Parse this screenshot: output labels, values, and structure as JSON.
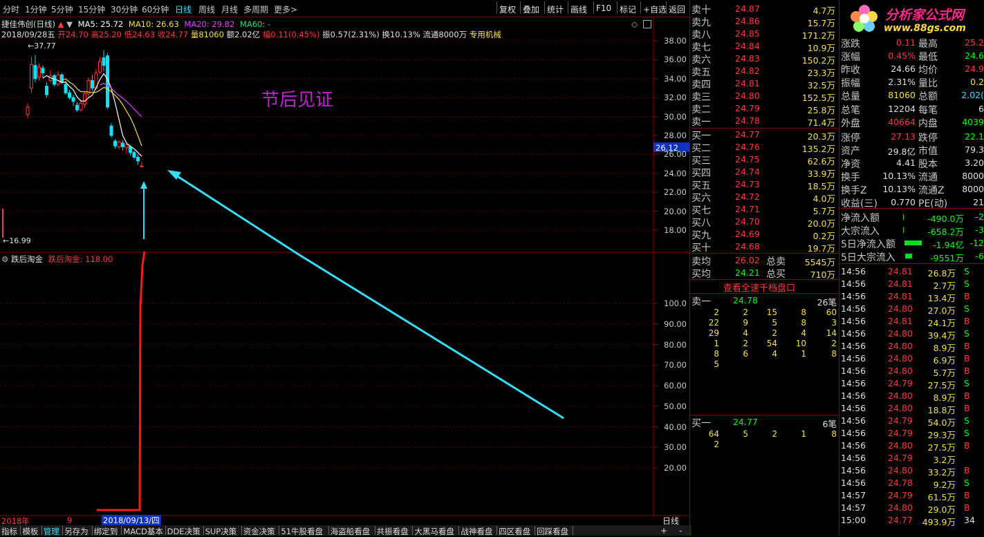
{
  "colors": {
    "up": "#ff3a3a",
    "down": "#00e5ff",
    "ma5": "#ffffff",
    "ma10": "#f4e04a",
    "ma20": "#e040fb",
    "accent": "#35e0ff",
    "grid": "#8c0000",
    "logo": "#ff2a8a"
  },
  "periods": [
    "分时",
    "1分钟",
    "5分钟",
    "15分钟",
    "30分钟",
    "60分钟",
    "日线",
    "周线",
    "月线",
    "多周期",
    "更多>"
  ],
  "active_period": "日线",
  "tools": [
    "复权",
    "叠加",
    "统计",
    "画线",
    "F10",
    "标记",
    "+自选",
    "返回"
  ],
  "stock": {
    "name": "捷佳伟创(日线)",
    "ma5": "MA5: 25.72",
    "ma10": "MA10: 26.63",
    "ma20": "MA20: 29.82",
    "ma60": "MA60: -",
    "line2": {
      "date": "2018/09/28五",
      "open": "开24.70",
      "high": "高25.20",
      "low": "低24.63",
      "close": "收24.77",
      "vol": "量81060",
      "amt": "额2.02亿",
      "chg": "幅0.11(0.45%)",
      "amp": "振0.57(2.31%)",
      "turn": "换10.13%",
      "float": "流通8000万",
      "sector": "专用机械"
    },
    "hi_label": "37.77",
    "lo_label": "16.99",
    "cur_price": "26.12"
  },
  "main_chart": {
    "annotation": "节后见证",
    "yticks": [
      "38.00",
      "36.00",
      "34.00",
      "32.00",
      "30.00",
      "28.00",
      "26.00",
      "24.00",
      "22.00",
      "20.00",
      "18.00"
    ],
    "candles": [
      {
        "o": 30.2,
        "c": 31.0,
        "h": 31.4,
        "l": 29.8
      },
      {
        "o": 33.0,
        "c": 35.5,
        "h": 36.3,
        "l": 32.5
      },
      {
        "o": 35.4,
        "c": 34.0,
        "h": 36.5,
        "l": 33.6
      },
      {
        "o": 34.2,
        "c": 35.2,
        "h": 35.6,
        "l": 33.8
      },
      {
        "o": 35.1,
        "c": 34.6,
        "h": 35.4,
        "l": 34.1
      },
      {
        "o": 33.2,
        "c": 32.3,
        "h": 33.6,
        "l": 32.0
      },
      {
        "o": 33.8,
        "c": 34.3,
        "h": 34.9,
        "l": 33.6
      },
      {
        "o": 34.3,
        "c": 33.4,
        "h": 34.5,
        "l": 33.2
      },
      {
        "o": 33.4,
        "c": 34.4,
        "h": 34.8,
        "l": 33.2
      },
      {
        "o": 34.4,
        "c": 33.6,
        "h": 34.6,
        "l": 33.4
      },
      {
        "o": 33.4,
        "c": 32.5,
        "h": 33.8,
        "l": 32.3
      },
      {
        "o": 32.5,
        "c": 32.0,
        "h": 32.8,
        "l": 31.8
      },
      {
        "o": 32.0,
        "c": 31.6,
        "h": 32.3,
        "l": 31.1
      },
      {
        "o": 31.2,
        "c": 30.7,
        "h": 31.5,
        "l": 30.5
      },
      {
        "o": 30.7,
        "c": 31.4,
        "h": 31.8,
        "l": 30.5
      },
      {
        "o": 31.3,
        "c": 32.4,
        "h": 32.6,
        "l": 30.9
      },
      {
        "o": 32.4,
        "c": 33.8,
        "h": 34.1,
        "l": 32.0
      },
      {
        "o": 33.8,
        "c": 33.0,
        "h": 34.4,
        "l": 32.7
      },
      {
        "o": 33.0,
        "c": 34.6,
        "h": 35.0,
        "l": 32.8
      },
      {
        "o": 34.7,
        "c": 35.8,
        "h": 36.3,
        "l": 34.5
      },
      {
        "o": 36.2,
        "c": 35.4,
        "h": 37.0,
        "l": 34.8
      },
      {
        "o": 36.4,
        "c": 31.0,
        "h": 36.7,
        "l": 30.8
      },
      {
        "o": 29.0,
        "c": 28.0,
        "h": 29.3,
        "l": 27.8
      },
      {
        "o": 27.4,
        "c": 26.9,
        "h": 27.6,
        "l": 26.6
      },
      {
        "o": 26.8,
        "c": 27.3,
        "h": 27.5,
        "l": 26.5
      },
      {
        "o": 27.2,
        "c": 26.8,
        "h": 27.5,
        "l": 26.4
      },
      {
        "o": 26.7,
        "c": 27.0,
        "h": 27.3,
        "l": 26.1
      },
      {
        "o": 26.8,
        "c": 26.2,
        "h": 27.0,
        "l": 25.9
      },
      {
        "o": 26.2,
        "c": 25.7,
        "h": 26.4,
        "l": 25.5
      },
      {
        "o": 25.7,
        "c": 25.3,
        "h": 26.0,
        "l": 24.9
      },
      {
        "o": 24.7,
        "c": 24.77,
        "h": 25.2,
        "l": 24.63
      }
    ]
  },
  "indicator": {
    "name": "跌后淘金",
    "series": "跌后淘金: 118.00",
    "yticks": [
      "100.0",
      "90.00",
      "80.00",
      "70.00",
      "60.00",
      "50.00",
      "40.00",
      "30.00",
      "20.00"
    ]
  },
  "date_bar": {
    "year": "2018年",
    "month": "9",
    "cursor": "2018/09/13/四",
    "cycle": "日线"
  },
  "bottom_tabs": [
    "指标",
    "模板",
    "管理",
    "另存为",
    "绑定到",
    "MACD基本",
    "DDE决策",
    "SUP决策",
    "资金决策",
    "51牛股看盘",
    "海盗船看盘",
    "共振看盘",
    "大黑马看盘",
    "战神看盘",
    "四区看盘",
    "回踩看盘"
  ],
  "bottom_active": "管理",
  "sell": [
    {
      "label": "卖十",
      "px": "24.87",
      "vol": "4.7万"
    },
    {
      "label": "卖九",
      "px": "24.86",
      "vol": "15.7万"
    },
    {
      "label": "卖八",
      "px": "24.85",
      "vol": "171.2万"
    },
    {
      "label": "卖七",
      "px": "24.84",
      "vol": "10.9万"
    },
    {
      "label": "卖六",
      "px": "24.83",
      "vol": "150.2万"
    },
    {
      "label": "卖五",
      "px": "24.82",
      "vol": "23.3万"
    },
    {
      "label": "卖四",
      "px": "24.81",
      "vol": "32.5万"
    },
    {
      "label": "卖三",
      "px": "24.80",
      "vol": "152.5万"
    },
    {
      "label": "卖二",
      "px": "24.79",
      "vol": "25.8万"
    },
    {
      "label": "卖一",
      "px": "24.78",
      "vol": "71.4万"
    }
  ],
  "buy": [
    {
      "label": "买一",
      "px": "24.77",
      "vol": "20.3万"
    },
    {
      "label": "买二",
      "px": "24.76",
      "vol": "135.2万"
    },
    {
      "label": "买三",
      "px": "24.75",
      "vol": "62.6万"
    },
    {
      "label": "买四",
      "px": "24.74",
      "vol": "33.9万"
    },
    {
      "label": "买五",
      "px": "24.73",
      "vol": "18.5万"
    },
    {
      "label": "买六",
      "px": "24.72",
      "vol": "4.0万"
    },
    {
      "label": "买七",
      "px": "24.71",
      "vol": "5.7万"
    },
    {
      "label": "买八",
      "px": "24.70",
      "vol": "20.0万"
    },
    {
      "label": "买九",
      "px": "24.69",
      "vol": "0.2万"
    },
    {
      "label": "买十",
      "px": "24.68",
      "vol": "19.7万"
    }
  ],
  "avg": {
    "sell_label": "卖均",
    "sell_px": "26.02",
    "sell_total_label": "总卖",
    "sell_total": "5545万",
    "buy_label": "买均",
    "buy_px": "24.21",
    "buy_total_label": "总买",
    "buy_total": "710万"
  },
  "depth_link": "查看全速千档盘口",
  "queue_sell": {
    "label": "卖一",
    "px": "24.78",
    "count": "26笔",
    "rows": [
      [
        "2",
        "2",
        "15",
        "8",
        "60"
      ],
      [
        "22",
        "9",
        "5",
        "8",
        "3"
      ],
      [
        "29",
        "4",
        "2",
        "4",
        "14"
      ],
      [
        "1",
        "2",
        "54",
        "10",
        "2"
      ],
      [
        "8",
        "6",
        "4",
        "1",
        "8"
      ],
      [
        "5",
        "",
        "",
        "",
        ""
      ]
    ]
  },
  "queue_buy": {
    "label": "买一",
    "px": "24.77",
    "count": "6笔",
    "rows": [
      [
        "64",
        "5",
        "2",
        "1",
        "8"
      ],
      [
        "2",
        "",
        "",
        "",
        ""
      ]
    ]
  },
  "logo": {
    "text": "分析家公式网",
    "url": "www.88gs.com"
  },
  "quote": [
    {
      "l": "涨跌",
      "v": "0.11",
      "l2": "最高",
      "v2": "25.2",
      "c": "#ff3a3a",
      "c2": "#ff3a3a"
    },
    {
      "l": "涨幅",
      "v": "0.45%",
      "l2": "最低",
      "v2": "24.6",
      "c": "#ff3a3a",
      "c2": "#00ff00"
    },
    {
      "l": "昨收",
      "v": "24.66",
      "l2": "均价",
      "v2": "24.9",
      "c": "#e0e0e0",
      "c2": "#ff3a3a"
    },
    {
      "l": "振幅",
      "v": "2.31%",
      "l2": "量比",
      "v2": "0.2",
      "c": "#e0e0e0",
      "c2": "#f4e04a"
    },
    {
      "l": "总量",
      "v": "81060",
      "l2": "总额",
      "v2": "2.02(",
      "c": "#f4e04a",
      "c2": "#35e0ff"
    },
    {
      "l": "总笔",
      "v": "12204",
      "l2": "每笔",
      "v2": "6",
      "c": "#e0e0e0",
      "c2": "#e0e0e0"
    },
    {
      "l": "外盘",
      "v": "40664",
      "l2": "内盘",
      "v2": "4039",
      "c": "#ff3a3a",
      "c2": "#00ff00"
    },
    {
      "l": "涨停",
      "v": "27.13",
      "l2": "跌停",
      "v2": "22.1",
      "c": "#ff3a3a",
      "c2": "#00ff00"
    },
    {
      "l": "资产",
      "v": "29.8亿",
      "l2": "市值",
      "v2": "79.3",
      "c": "#e0e0e0",
      "c2": "#e0e0e0"
    },
    {
      "l": "净资",
      "v": "4.41",
      "l2": "股本",
      "v2": "3.20",
      "c": "#e0e0e0",
      "c2": "#e0e0e0"
    },
    {
      "l": "换手",
      "v": "10.13%",
      "l2": "流通",
      "v2": "8000",
      "c": "#e0e0e0",
      "c2": "#e0e0e0"
    },
    {
      "l": "换手Z",
      "v": "10.13%",
      "l2": "流通Z",
      "v2": "8000",
      "c": "#e0e0e0",
      "c2": "#e0e0e0"
    },
    {
      "l": "收益(三)",
      "v": "0.770",
      "l2": "PE(动)",
      "v2": "21",
      "c": "#e0e0e0",
      "c2": "#e0e0e0"
    }
  ],
  "flows": [
    {
      "l": "净流入额",
      "v": "-490.0万",
      "v2": "-2",
      "bar": 0
    },
    {
      "l": "大宗流入",
      "v": "-658.2万",
      "v2": "-3",
      "bar": 0
    },
    {
      "l": "5日净流入额",
      "v": "-1.94亿",
      "v2": "-12",
      "bar": 1
    },
    {
      "l": "5日大宗流入",
      "v": "-9551万",
      "v2": "-6",
      "bar": 1
    }
  ],
  "ticks": [
    {
      "t": "14:56",
      "p": "24.81",
      "v": "26.8万",
      "d": "S"
    },
    {
      "t": "14:56",
      "p": "24.81",
      "v": "2.7万",
      "d": "S"
    },
    {
      "t": "14:56",
      "p": "24.81",
      "v": "13.4万",
      "d": "B"
    },
    {
      "t": "14:56",
      "p": "24.80",
      "v": "27.0万",
      "d": "S"
    },
    {
      "t": "14:56",
      "p": "24.81",
      "v": "24.1万",
      "d": "B"
    },
    {
      "t": "14:56",
      "p": "24.80",
      "v": "39.4万",
      "d": "S"
    },
    {
      "t": "14:56",
      "p": "24.80",
      "v": "8.9万",
      "d": "B"
    },
    {
      "t": "14:56",
      "p": "24.80",
      "v": "6.9万",
      "d": "B"
    },
    {
      "t": "14:56",
      "p": "24.80",
      "v": "5.7万",
      "d": "B"
    },
    {
      "t": "14:56",
      "p": "24.79",
      "v": "27.5万",
      "d": "S"
    },
    {
      "t": "14:56",
      "p": "24.80",
      "v": "8.9万",
      "d": "B"
    },
    {
      "t": "14:56",
      "p": "24.80",
      "v": "18.8万",
      "d": "B"
    },
    {
      "t": "14:56",
      "p": "24.79",
      "v": "54.0万",
      "d": "S"
    },
    {
      "t": "14:56",
      "p": "24.79",
      "v": "29.3万",
      "d": "S"
    },
    {
      "t": "14:56",
      "p": "24.80",
      "v": "27.5万",
      "d": "B"
    },
    {
      "t": "14:56",
      "p": "24.79",
      "v": "3.2万",
      "d": ""
    },
    {
      "t": "14:56",
      "p": "24.80",
      "v": "33.2万",
      "d": "B"
    },
    {
      "t": "14:56",
      "p": "24.78",
      "v": "9.2万",
      "d": "S"
    },
    {
      "t": "14:57",
      "p": "24.79",
      "v": "61.5万",
      "d": "B"
    },
    {
      "t": "14:57",
      "p": "24.80",
      "v": "29.0万",
      "d": "B"
    },
    {
      "t": "15:00",
      "p": "24.77",
      "v": "493.9万",
      "d": "34"
    }
  ]
}
